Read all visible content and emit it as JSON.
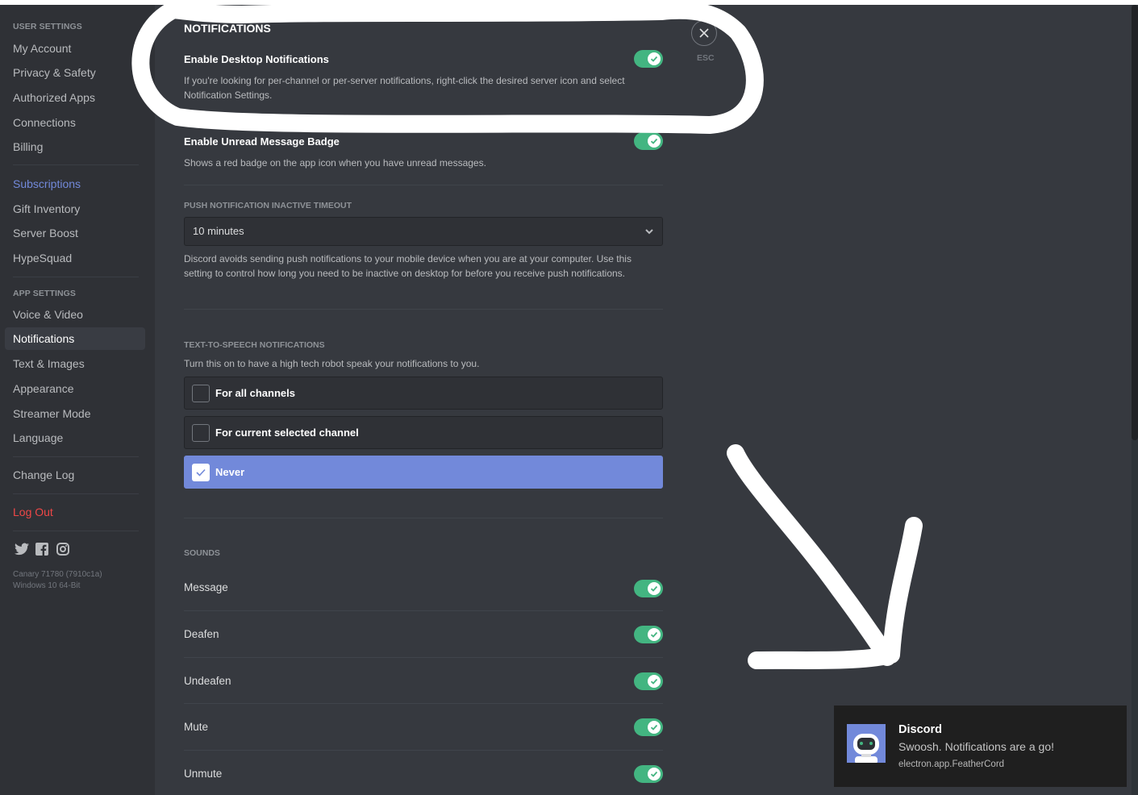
{
  "sidebar": {
    "user_settings_header": "USER SETTINGS",
    "user_items": [
      {
        "label": "My Account"
      },
      {
        "label": "Privacy & Safety"
      },
      {
        "label": "Authorized Apps"
      },
      {
        "label": "Connections"
      },
      {
        "label": "Billing"
      }
    ],
    "billing_items": [
      {
        "label": "Subscriptions"
      },
      {
        "label": "Gift Inventory"
      },
      {
        "label": "Server Boost"
      },
      {
        "label": "HypeSquad"
      }
    ],
    "app_settings_header": "APP SETTINGS",
    "app_items": [
      {
        "label": "Voice & Video"
      },
      {
        "label": "Notifications",
        "active": true
      },
      {
        "label": "Text & Images"
      },
      {
        "label": "Appearance"
      },
      {
        "label": "Streamer Mode"
      },
      {
        "label": "Language"
      }
    ],
    "change_log": "Change Log",
    "log_out": "Log Out",
    "social_icons": [
      "twitter-icon",
      "facebook-icon",
      "instagram-icon"
    ],
    "version_line1": "Canary 71780 (7910c1a)",
    "version_line2": "Windows 10 64-Bit"
  },
  "main": {
    "title": "NOTIFICATIONS",
    "desktop_notifications": {
      "title": "Enable Desktop Notifications",
      "description": "If you're looking for per-channel or per-server notifications, right-click the desired server icon and select Notification Settings.",
      "enabled": true
    },
    "unread_badge": {
      "title": "Enable Unread Message Badge",
      "description": "Shows a red badge on the app icon when you have unread messages.",
      "enabled": true
    },
    "push_timeout": {
      "label": "PUSH NOTIFICATION INACTIVE TIMEOUT",
      "value": "10 minutes",
      "description": "Discord avoids sending push notifications to your mobile device when you are at your computer. Use this setting to control how long you need to be inactive on desktop for before you receive push notifications."
    },
    "tts": {
      "label": "TEXT-TO-SPEECH NOTIFICATIONS",
      "description": "Turn this on to have a high tech robot speak your notifications to you.",
      "options": [
        {
          "label": "For all channels",
          "selected": false
        },
        {
          "label": "For current selected channel",
          "selected": false
        },
        {
          "label": "Never",
          "selected": true
        }
      ]
    },
    "sounds": {
      "label": "SOUNDS",
      "items": [
        {
          "label": "Message",
          "enabled": true
        },
        {
          "label": "Deafen",
          "enabled": true
        },
        {
          "label": "Undeafen",
          "enabled": true
        },
        {
          "label": "Mute",
          "enabled": true
        },
        {
          "label": "Unmute",
          "enabled": true
        }
      ]
    },
    "close_label": "ESC"
  },
  "toast": {
    "app": "Discord",
    "message": "Swoosh. Notifications are a go!",
    "source": "electron.app.FeatherCord"
  },
  "colors": {
    "toggle_on": "#43b581",
    "accent": "#7289da",
    "danger": "#f04747"
  }
}
